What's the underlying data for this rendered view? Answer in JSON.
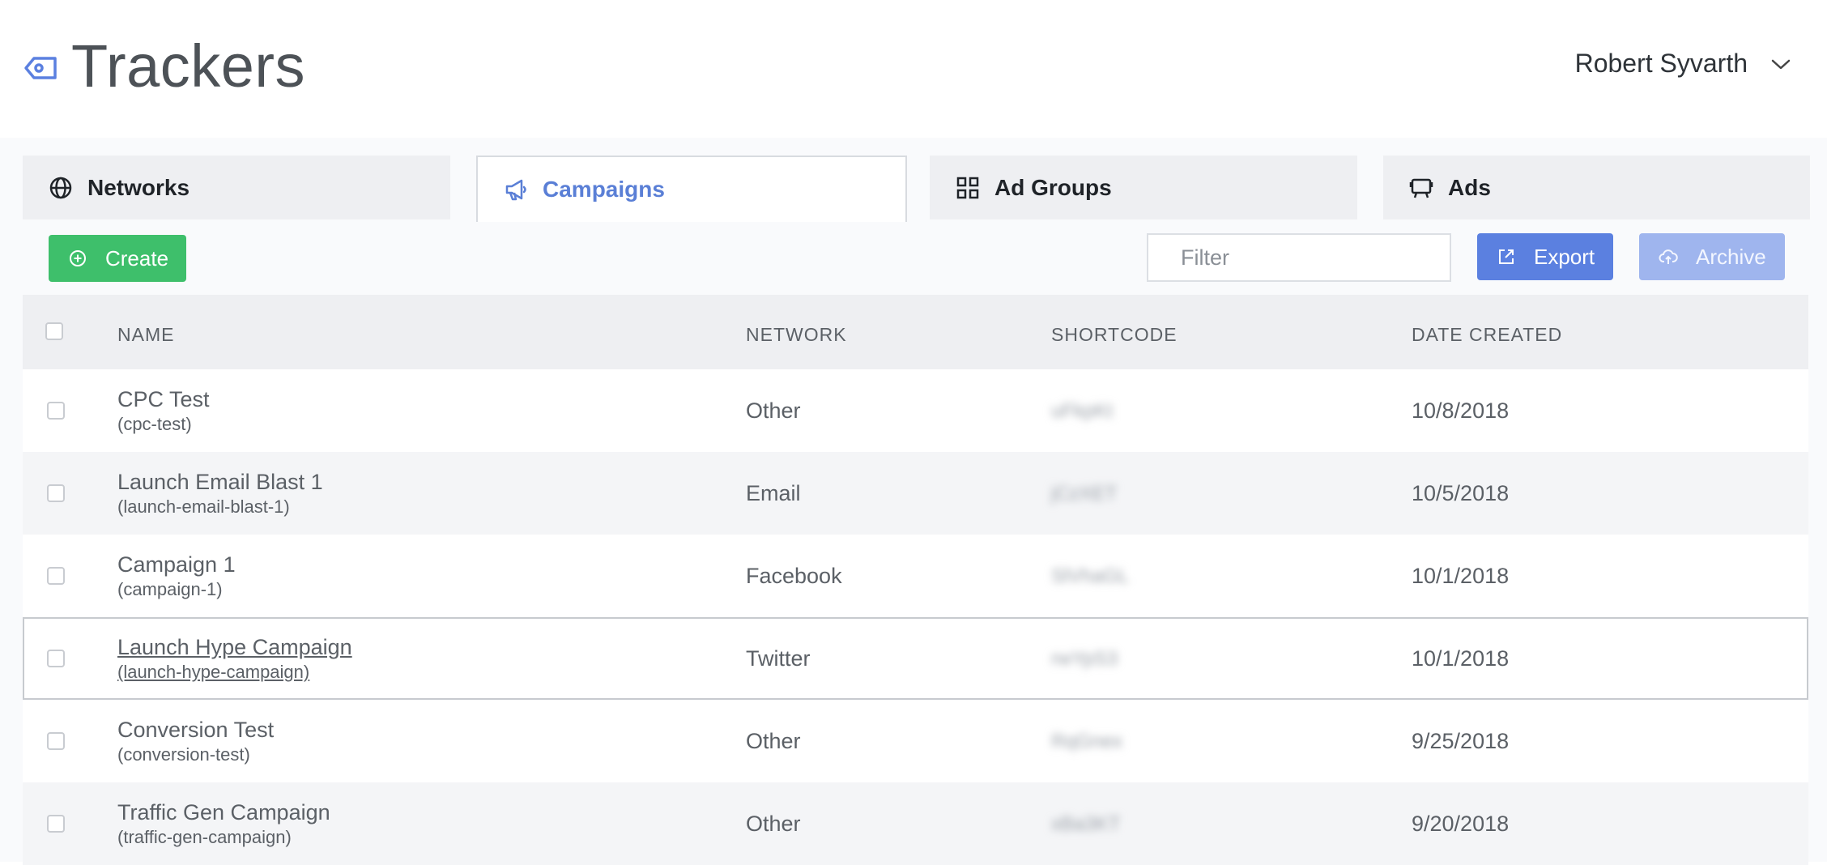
{
  "header": {
    "title": "Trackers",
    "title_icon": "tag-icon",
    "user_name": "Robert Syvarth"
  },
  "tabs": [
    {
      "label": "Networks",
      "icon": "globe-icon",
      "active": false
    },
    {
      "label": "Campaigns",
      "icon": "megaphone-icon",
      "active": true
    },
    {
      "label": "Ad Groups",
      "icon": "grid-icon",
      "active": false
    },
    {
      "label": "Ads",
      "icon": "billboard-icon",
      "active": false
    }
  ],
  "toolbar": {
    "create_label": "Create",
    "filter_placeholder": "Filter",
    "export_label": "Export",
    "archive_label": "Archive"
  },
  "table": {
    "columns": [
      "NAME",
      "NETWORK",
      "SHORTCODE",
      "DATE CREATED"
    ],
    "rows": [
      {
        "name": "CPC Test",
        "slug": "(cpc-test)",
        "network": "Other",
        "shortcode": "uFkpKt",
        "date": "10/8/2018"
      },
      {
        "name": "Launch Email Blast 1",
        "slug": "(launch-email-blast-1)",
        "network": "Email",
        "shortcode": "jCzXET",
        "date": "10/5/2018"
      },
      {
        "name": "Campaign 1",
        "slug": "(campaign-1)",
        "network": "Facebook",
        "shortcode": "SlVhaGL",
        "date": "10/1/2018"
      },
      {
        "name": "Launch Hype Campaign",
        "slug": "(launch-hype-campaign)",
        "network": "Twitter",
        "shortcode": "rwYpS3",
        "date": "10/1/2018"
      },
      {
        "name": "Conversion Test",
        "slug": "(conversion-test)",
        "network": "Other",
        "shortcode": "RqGnex",
        "date": "9/25/2018"
      },
      {
        "name": "Traffic Gen Campaign",
        "slug": "(traffic-gen-campaign)",
        "network": "Other",
        "shortcode": "xBa3KT",
        "date": "9/20/2018"
      }
    ]
  },
  "colors": {
    "accent": "#5b80e0",
    "create_green": "#3ebf6b",
    "archive_disabled": "#9fb5ee",
    "active_tab_text": "#5a7fd6"
  }
}
